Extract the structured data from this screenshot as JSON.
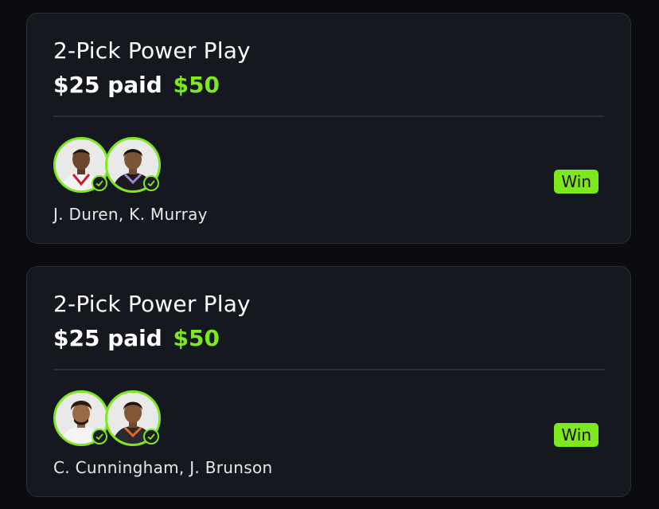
{
  "colors": {
    "background": "#0b0c10",
    "card": "#16181f",
    "accent_green": "#7ee81f",
    "text": "#ffffff"
  },
  "entries": [
    {
      "title": "2-Pick Power Play",
      "paid_label": "$25 paid",
      "payout": "$50",
      "players": "J. Duren, K. Murray",
      "status": "Win",
      "avatars": [
        "player-headshot-icon",
        "player-headshot-icon"
      ],
      "check_icon": "check-circle-icon"
    },
    {
      "title": "2-Pick Power Play",
      "paid_label": "$25 paid",
      "payout": "$50",
      "players": "C. Cunningham, J. Brunson",
      "status": "Win",
      "avatars": [
        "player-headshot-icon",
        "player-headshot-icon"
      ],
      "check_icon": "check-circle-icon"
    }
  ]
}
